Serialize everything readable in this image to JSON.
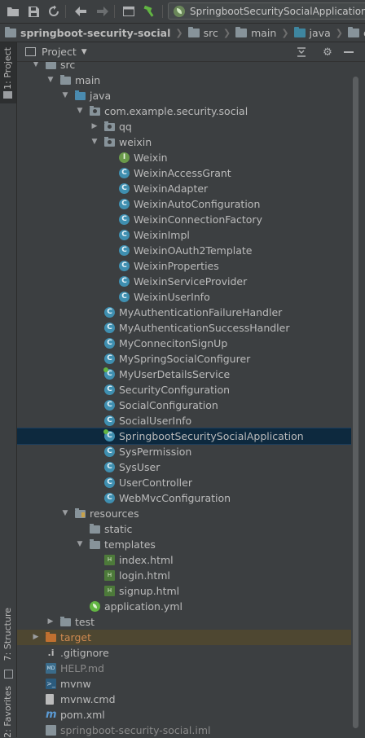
{
  "toolbar": {
    "run_config": "SpringbootSecuritySocialApplication",
    "icons": [
      "folder-open-icon",
      "save-icon",
      "sync-icon",
      "back-icon",
      "forward-icon",
      "terminal-icon",
      "build-hammer-icon"
    ]
  },
  "breadcrumb": [
    {
      "label": "springboot-security-social",
      "bold": true
    },
    {
      "label": "src"
    },
    {
      "label": "main"
    },
    {
      "label": "java"
    },
    {
      "label": "com"
    },
    {
      "label": "e"
    }
  ],
  "side_tabs": {
    "project": "1: Project",
    "structure": "7: Structure",
    "favorites": "2: Favorites"
  },
  "panel": {
    "title": "Project"
  },
  "tree": [
    {
      "label": "src",
      "indent": 1,
      "arrow": "down",
      "icon": "folder"
    },
    {
      "label": "main",
      "indent": 2,
      "arrow": "down",
      "icon": "folder"
    },
    {
      "label": "java",
      "indent": 3,
      "arrow": "down",
      "icon": "folder-blue"
    },
    {
      "label": "com.example.security.social",
      "indent": 4,
      "arrow": "down",
      "icon": "package"
    },
    {
      "label": "qq",
      "indent": 5,
      "arrow": "right",
      "icon": "package"
    },
    {
      "label": "weixin",
      "indent": 5,
      "arrow": "down",
      "icon": "package"
    },
    {
      "label": "Weixin",
      "indent": 6,
      "icon": "interface"
    },
    {
      "label": "WeixinAccessGrant",
      "indent": 6,
      "icon": "class"
    },
    {
      "label": "WeixinAdapter",
      "indent": 6,
      "icon": "class"
    },
    {
      "label": "WeixinAutoConfiguration",
      "indent": 6,
      "icon": "class"
    },
    {
      "label": "WeixinConnectionFactory",
      "indent": 6,
      "icon": "class"
    },
    {
      "label": "WeixinImpl",
      "indent": 6,
      "icon": "class"
    },
    {
      "label": "WeixinOAuth2Template",
      "indent": 6,
      "icon": "class"
    },
    {
      "label": "WeixinProperties",
      "indent": 6,
      "icon": "class"
    },
    {
      "label": "WeixinServiceProvider",
      "indent": 6,
      "icon": "class"
    },
    {
      "label": "WeixinUserInfo",
      "indent": 6,
      "icon": "class"
    },
    {
      "label": "MyAuthenticationFailureHandler",
      "indent": 5,
      "icon": "class"
    },
    {
      "label": "MyAuthenticationSuccessHandler",
      "indent": 5,
      "icon": "class"
    },
    {
      "label": "MyConnecitonSignUp",
      "indent": 5,
      "icon": "class"
    },
    {
      "label": "MySpringSocialConfigurer",
      "indent": 5,
      "icon": "class"
    },
    {
      "label": "MyUserDetailsService",
      "indent": 5,
      "icon": "spring-class"
    },
    {
      "label": "SecurityConfiguration",
      "indent": 5,
      "icon": "class"
    },
    {
      "label": "SocialConfiguration",
      "indent": 5,
      "icon": "class"
    },
    {
      "label": "SocialUserInfo",
      "indent": 5,
      "icon": "class"
    },
    {
      "label": "SpringbootSecuritySocialApplication",
      "indent": 5,
      "icon": "spring-class",
      "selected": true
    },
    {
      "label": "SysPermission",
      "indent": 5,
      "icon": "class"
    },
    {
      "label": "SysUser",
      "indent": 5,
      "icon": "class"
    },
    {
      "label": "UserController",
      "indent": 5,
      "icon": "class"
    },
    {
      "label": "WebMvcConfiguration",
      "indent": 5,
      "icon": "class"
    },
    {
      "label": "resources",
      "indent": 3,
      "arrow": "down",
      "icon": "folder-res"
    },
    {
      "label": "static",
      "indent": 4,
      "icon": "folder"
    },
    {
      "label": "templates",
      "indent": 4,
      "arrow": "down",
      "icon": "folder"
    },
    {
      "label": "index.html",
      "indent": 5,
      "icon": "html"
    },
    {
      "label": "login.html",
      "indent": 5,
      "icon": "html"
    },
    {
      "label": "signup.html",
      "indent": 5,
      "icon": "html"
    },
    {
      "label": "application.yml",
      "indent": 4,
      "icon": "yml"
    },
    {
      "label": "test",
      "indent": 2,
      "arrow": "right",
      "icon": "folder"
    },
    {
      "label": "target",
      "indent": 1,
      "arrow": "right",
      "icon": "folder-orange",
      "highlight": true,
      "style": "orange"
    },
    {
      "label": ".gitignore",
      "indent": 1,
      "icon": "git"
    },
    {
      "label": "HELP.md",
      "indent": 1,
      "icon": "md",
      "style": "dim"
    },
    {
      "label": "mvnw",
      "indent": 1,
      "icon": "term"
    },
    {
      "label": "mvnw.cmd",
      "indent": 1,
      "icon": "file"
    },
    {
      "label": "pom.xml",
      "indent": 1,
      "icon": "maven"
    },
    {
      "label": "springboot-security-social.iml",
      "indent": 1,
      "icon": "iml",
      "style": "dim"
    }
  ]
}
